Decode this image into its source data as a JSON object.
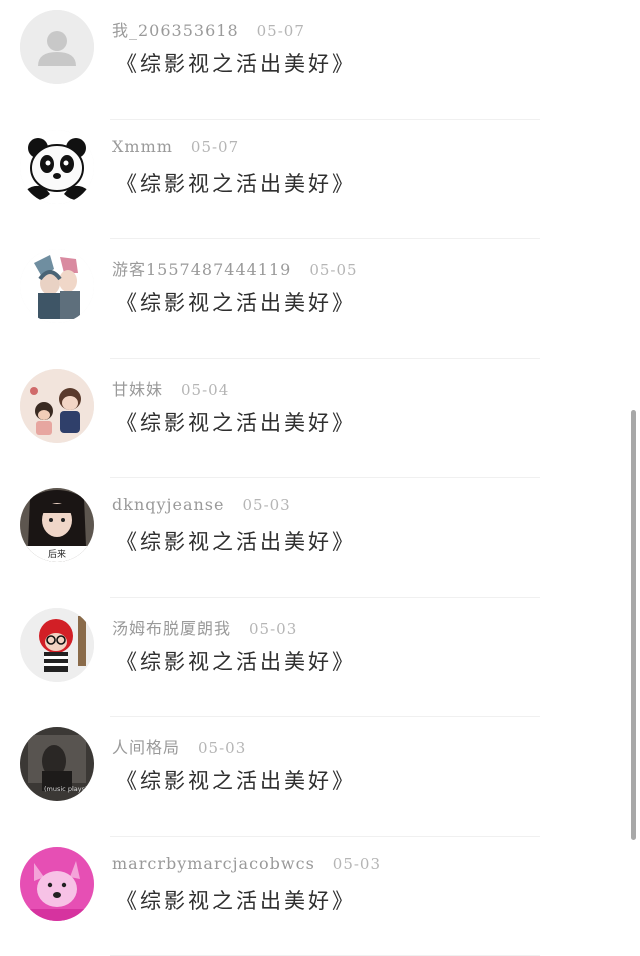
{
  "comments": [
    {
      "username": "我_206353618",
      "date": "05-07",
      "text": "《综影视之活出美好》",
      "avatar": "default-user-icon"
    },
    {
      "username": "Xmmm",
      "date": "05-07",
      "text": "《综影视之活出美好》",
      "avatar": "panda-avatar"
    },
    {
      "username": "游客1557487444119",
      "date": "05-05",
      "text": "《综影视之活出美好》",
      "avatar": "anime-character-avatar"
    },
    {
      "username": "甘妹妹",
      "date": "05-04",
      "text": "《综影视之活出美好》",
      "avatar": "cartoon-couple-avatar"
    },
    {
      "username": "dknqyjeanse",
      "date": "05-03",
      "text": "《综影视之活出美好》",
      "avatar": "girl-photo-avatar",
      "avatar_caption": "后来"
    },
    {
      "username": "汤姆布脱厦朗我",
      "date": "05-03",
      "text": "《综影视之活出美好》",
      "avatar": "red-hood-doll-avatar"
    },
    {
      "username": "人间格局",
      "date": "05-03",
      "text": "《综影视之活出美好》",
      "avatar": "music-plays-avatar",
      "avatar_caption": "(music plays)"
    },
    {
      "username": "marcrbymarcjacobwcs",
      "date": "05-03",
      "text": "《综影视之活出美好》",
      "avatar": "pink-doge-avatar"
    }
  ]
}
